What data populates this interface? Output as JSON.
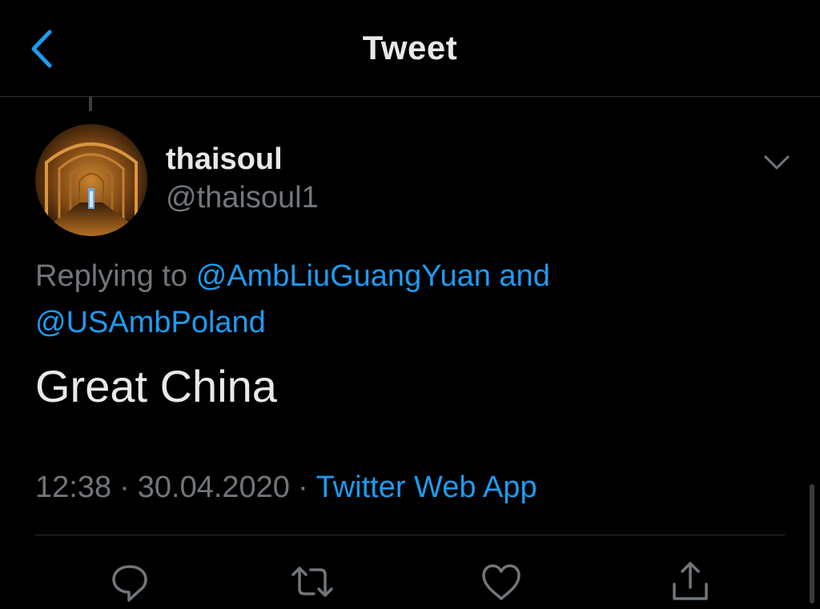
{
  "header": {
    "title": "Tweet",
    "back_icon": "chevron-left-icon",
    "accent_color": "#1d9bf0"
  },
  "tweet": {
    "author": {
      "display_name": "thaisoul",
      "handle": "@thaisoul1",
      "avatar": "avatar-photo"
    },
    "menu_icon": "chevron-down-icon",
    "reply": {
      "prefix": "Replying to",
      "mention_1": "@AmbLiuGuangYuan",
      "joiner": "and",
      "mention_2": "@USAmbPoland"
    },
    "text": "Great China",
    "time": "12:38",
    "date": "30.04.2020",
    "separator": "·",
    "source": "Twitter Web App"
  },
  "actions": [
    {
      "icon": "reply-icon"
    },
    {
      "icon": "retweet-icon"
    },
    {
      "icon": "like-icon"
    },
    {
      "icon": "share-icon"
    }
  ]
}
